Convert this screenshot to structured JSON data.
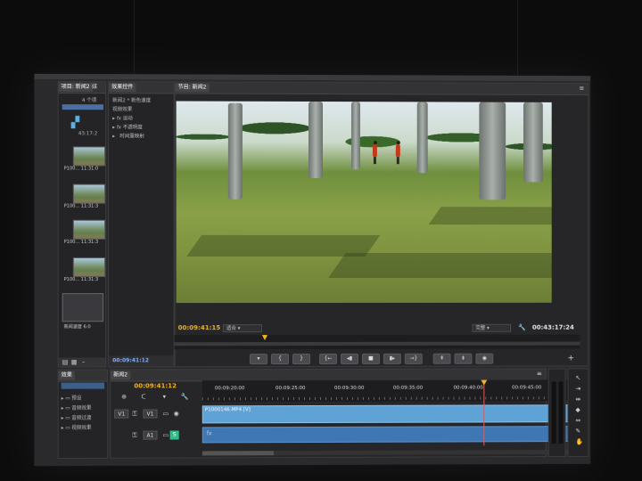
{
  "project_panel": {
    "tabs": [
      "项目: 新闻2",
      "媒"
    ],
    "items_count": "4 个项",
    "first_item_time": "43:17:2",
    "clips": [
      {
        "name": "P100...",
        "time": "11:31:0"
      },
      {
        "name": "P100...",
        "time": "11:31:3"
      },
      {
        "name": "P100...",
        "time": "11:31:3"
      },
      {
        "name": "P100...",
        "time": "11:31:3"
      },
      {
        "name": "新闻速度",
        "time": "6:0"
      }
    ]
  },
  "effects_panel": {
    "tab": "效果控件",
    "header": "新闻2 * 新色速度",
    "section": "视频效果",
    "items": [
      "运动",
      "不透明度",
      "时间重映射"
    ],
    "timecode": "00:09:41:12"
  },
  "program_monitor": {
    "tab": "节目: 新闻2",
    "timecode_in": "00:09:41:15",
    "fit_label": "适合",
    "quality_label": "完整",
    "duration": "00:43:17:24"
  },
  "effects_library": {
    "tab": "效果",
    "items": [
      "预设",
      "音频效果",
      "音频过渡",
      "视频效果"
    ]
  },
  "timeline": {
    "tab": "新闻2",
    "timecode": "00:09:41:12",
    "ruler_labels": [
      "00:09:20:00",
      "00:09:25:00",
      "00:09:30:00",
      "00:09:35:00",
      "00:09:40:00",
      "00:09:45:00"
    ],
    "video_track": "V1",
    "audio_track": "A1",
    "clip_label": "P1000146.MP4 [V]"
  },
  "colors": {
    "accent_timecode": "#f2b51e",
    "clip_video": "#5fa3d6",
    "clip_audio": "#3f77b5",
    "playhead": "#e05a5a"
  }
}
